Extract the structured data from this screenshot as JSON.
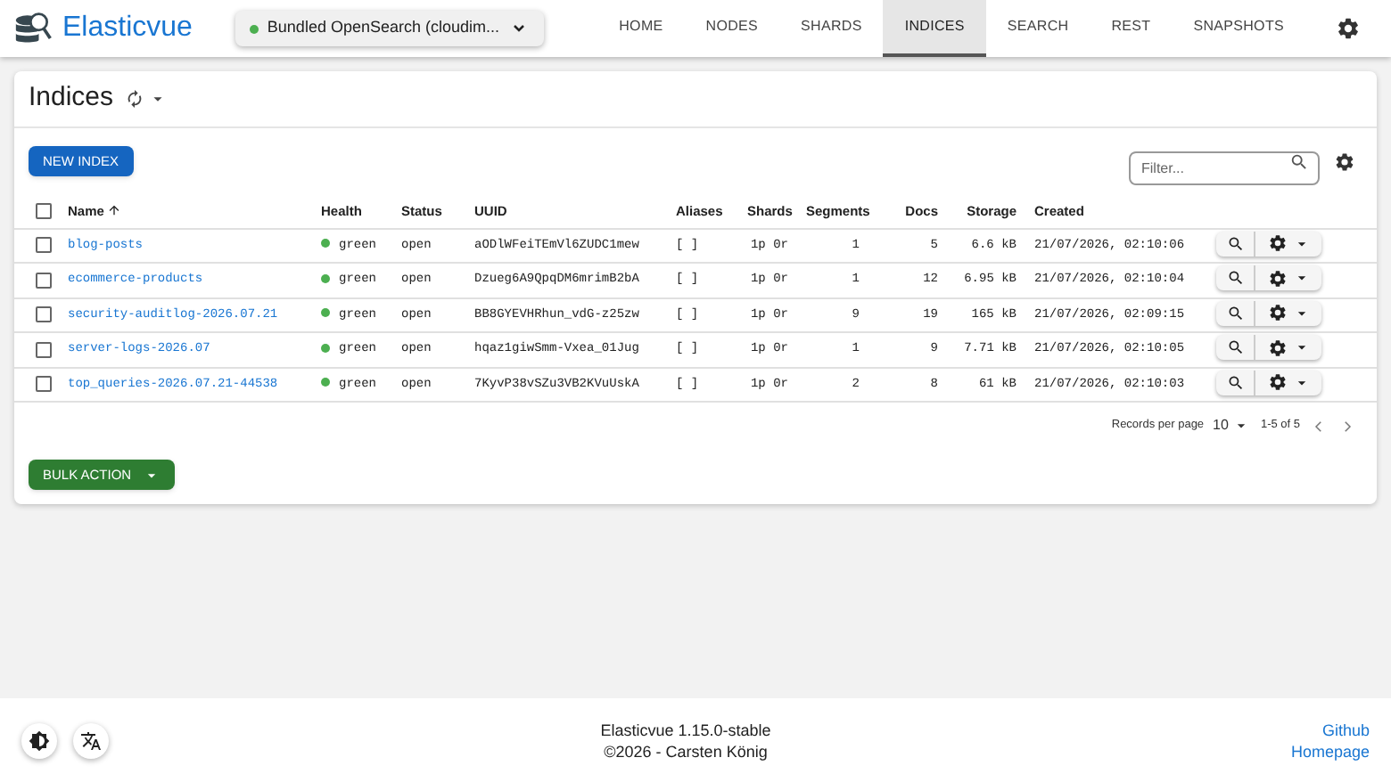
{
  "app": {
    "name": "Elasticvue"
  },
  "cluster": {
    "label": "Bundled OpenSearch (cloudim...",
    "color": "#4caf50"
  },
  "nav": [
    {
      "label": "HOME",
      "selected": false
    },
    {
      "label": "NODES",
      "selected": false
    },
    {
      "label": "SHARDS",
      "selected": false
    },
    {
      "label": "INDICES",
      "selected": true
    },
    {
      "label": "SEARCH",
      "selected": false
    },
    {
      "label": "REST",
      "selected": false
    },
    {
      "label": "SNAPSHOTS",
      "selected": false
    }
  ],
  "page": {
    "title": "Indices"
  },
  "new_index_button": "NEW INDEX",
  "filter": {
    "placeholder": "Filter..."
  },
  "table": {
    "columns": [
      {
        "label": "Name",
        "sorted": true
      },
      {
        "label": "Health",
        "sorted": false
      },
      {
        "label": "Status",
        "sorted": false
      },
      {
        "label": "UUID",
        "sorted": false
      },
      {
        "label": "Aliases",
        "sorted": false
      },
      {
        "label": "Shards",
        "sorted": false
      },
      {
        "label": "Segments",
        "sorted": false
      },
      {
        "label": "Docs",
        "sorted": false
      },
      {
        "label": "Storage",
        "sorted": false
      },
      {
        "label": "Created",
        "sorted": false
      }
    ],
    "all_selected": false,
    "rows": [
      {
        "selected": false,
        "name": "blog-posts",
        "health": "green",
        "color": "#4caf50",
        "status": "open",
        "uuid": "aODlWFeiTEmVl6ZUDC1mew",
        "aliases": "[ ]",
        "shards": "1p  0r",
        "segments": "1",
        "docs": "5",
        "storage": "6.6 kB",
        "created": "21/07/2026, 02:10:06"
      },
      {
        "selected": false,
        "name": "ecommerce-products",
        "health": "green",
        "color": "#4caf50",
        "status": "open",
        "uuid": "Dzueg6A9QpqDM6mrimB2bA",
        "aliases": "[ ]",
        "shards": "1p  0r",
        "segments": "1",
        "docs": "12",
        "storage": "6.95 kB",
        "created": "21/07/2026, 02:10:04"
      },
      {
        "selected": false,
        "name": "security-auditlog-2026.07.21",
        "health": "green",
        "color": "#4caf50",
        "status": "open",
        "uuid": "BB8GYEVHRhun_vdG-z25zw",
        "aliases": "[ ]",
        "shards": "1p  0r",
        "segments": "9",
        "docs": "19",
        "storage": "165 kB",
        "created": "21/07/2026, 02:09:15"
      },
      {
        "selected": false,
        "name": "server-logs-2026.07",
        "health": "green",
        "color": "#4caf50",
        "status": "open",
        "uuid": "hqaz1giwSmm-Vxea_01Jug",
        "aliases": "[ ]",
        "shards": "1p  0r",
        "segments": "1",
        "docs": "9",
        "storage": "7.71 kB",
        "created": "21/07/2026, 02:10:05"
      },
      {
        "selected": false,
        "name": "top_queries-2026.07.21-44538",
        "health": "green",
        "color": "#4caf50",
        "status": "open",
        "uuid": "7KyvP38vSZu3VB2KVuUskA",
        "aliases": "[ ]",
        "shards": "1p  0r",
        "segments": "2",
        "docs": "8",
        "storage": "61 kB",
        "created": "21/07/2026, 02:10:03"
      }
    ]
  },
  "pagination": {
    "label": "Records per page",
    "per_page": "10",
    "range": "1-5 of 5"
  },
  "bulk_action_button": "BULK ACTION",
  "footer": {
    "version": "Elasticvue 1.15.0-stable",
    "copyright": "©2026 - Carsten König",
    "links": [
      "Github",
      "Homepage"
    ]
  }
}
